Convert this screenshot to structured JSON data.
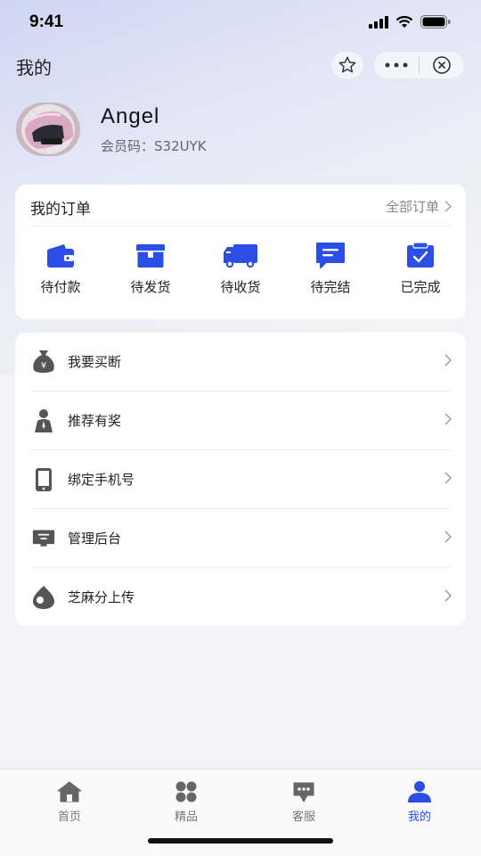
{
  "status_bar": {
    "time": "9:41"
  },
  "header": {
    "title": "我的"
  },
  "profile": {
    "name": "Angel",
    "member_code": "会员码：S32UYK"
  },
  "orders": {
    "title": "我的订单",
    "all_label": "全部订单",
    "items": [
      {
        "label": "待付款",
        "icon": "wallet-icon"
      },
      {
        "label": "待发货",
        "icon": "box-icon"
      },
      {
        "label": "待收货",
        "icon": "truck-icon"
      },
      {
        "label": "待完结",
        "icon": "message-icon"
      },
      {
        "label": "已完成",
        "icon": "clipboard-check-icon"
      }
    ]
  },
  "menu": {
    "items": [
      {
        "label": "我要买断",
        "icon": "money-bag-icon"
      },
      {
        "label": "推荐有奖",
        "icon": "person-icon"
      },
      {
        "label": "绑定手机号",
        "icon": "phone-icon"
      },
      {
        "label": "管理后台",
        "icon": "monitor-icon"
      },
      {
        "label": "芝麻分上传",
        "icon": "sesame-icon"
      }
    ]
  },
  "tabbar": {
    "items": [
      {
        "label": "首页",
        "icon": "home-icon",
        "active": false
      },
      {
        "label": "精品",
        "icon": "grid-icon",
        "active": false
      },
      {
        "label": "客服",
        "icon": "chat-icon",
        "active": false
      },
      {
        "label": "我的",
        "icon": "user-icon",
        "active": true
      }
    ]
  },
  "colors": {
    "accent": "#2b4ee6",
    "icon_gray": "#5a5a5a"
  }
}
